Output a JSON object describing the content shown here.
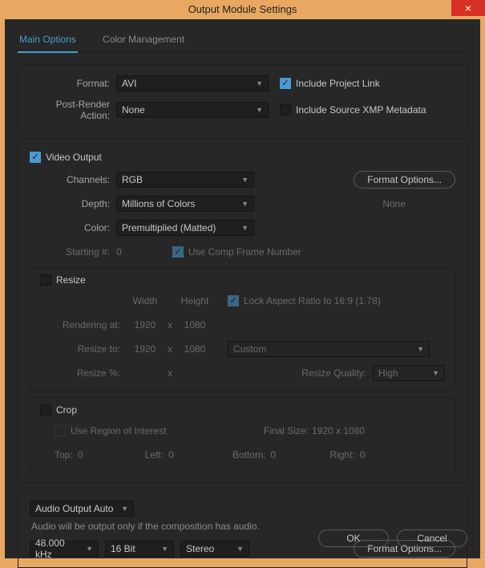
{
  "window": {
    "title": "Output Module Settings"
  },
  "tabs": {
    "main": "Main Options",
    "color": "Color Management"
  },
  "top": {
    "format_label": "Format:",
    "format_value": "AVI",
    "post_render_label": "Post-Render Action:",
    "post_render_value": "None",
    "include_project_link": "Include Project Link",
    "include_xmp": "Include Source XMP Metadata"
  },
  "video": {
    "header": "Video Output",
    "channels_label": "Channels:",
    "channels_value": "RGB",
    "depth_label": "Depth:",
    "depth_value": "Millions of Colors",
    "color_label": "Color:",
    "color_value": "Premultiplied (Matted)",
    "starting_label": "Starting #:",
    "starting_value": "0",
    "use_comp_frame": "Use Comp Frame Number",
    "format_options": "Format Options...",
    "format_options_status": "None"
  },
  "resize": {
    "title": "Resize",
    "width": "Width",
    "height": "Height",
    "lock": "Lock Aspect Ratio to 16:9 (1.78)",
    "rendering_at": "Rendering at:",
    "rendering_w": "1920",
    "rendering_h": "1080",
    "resize_to": "Resize to:",
    "resize_w": "1920",
    "resize_h": "1080",
    "preset": "Custom",
    "resize_pct": "Resize %:",
    "resize_quality_label": "Resize Quality:",
    "resize_quality_value": "High",
    "x": "x"
  },
  "crop": {
    "title": "Crop",
    "use_roi": "Use Region of Interest",
    "final_size_label": "Final Size:",
    "final_size_value": "1920 x 1080",
    "top": "Top:",
    "top_v": "0",
    "left": "Left:",
    "left_v": "0",
    "bottom": "Bottom:",
    "bottom_v": "0",
    "right": "Right:",
    "right_v": "0"
  },
  "audio": {
    "mode": "Audio Output Auto",
    "note": "Audio will be output only if the composition has audio.",
    "rate": "48.000 kHz",
    "depth": "16 Bit",
    "channels": "Stereo",
    "format_options": "Format Options..."
  },
  "buttons": {
    "ok": "OK",
    "cancel": "Cancel"
  }
}
